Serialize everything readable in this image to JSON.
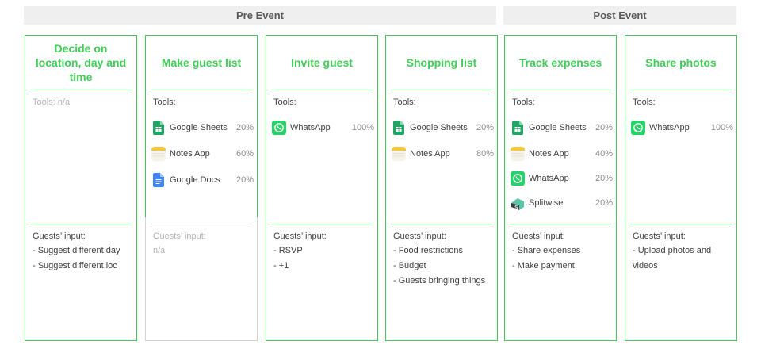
{
  "phases": {
    "pre": "Pre Event",
    "post": "Post Event"
  },
  "tools_label": "Tools:",
  "tools_na_label": "Tools: n/a",
  "inputs_label": "Guests’ input:",
  "colors": {
    "accent": "#3fce56",
    "border": "#47c757",
    "phase_bg": "#efefef"
  },
  "cards": [
    {
      "title": "Decide on location, day and time",
      "tools": [],
      "inputs": [
        "- Suggest different day",
        "- Suggest different loc"
      ]
    },
    {
      "title": "Make guest list",
      "tools": [
        {
          "name": "Google Sheets",
          "pct": "20%",
          "icon": "google-sheets-icon"
        },
        {
          "name": "Notes App",
          "pct": "60%",
          "icon": "notes-app-icon"
        },
        {
          "name": "Google Docs",
          "pct": "20%",
          "icon": "google-docs-icon"
        }
      ],
      "inputs": [
        "n/a"
      ]
    },
    {
      "title": "Invite guest",
      "tools": [
        {
          "name": "WhatsApp",
          "pct": "100%",
          "icon": "whatsapp-icon"
        }
      ],
      "inputs": [
        "- RSVP",
        "- +1"
      ]
    },
    {
      "title": "Shopping list",
      "tools": [
        {
          "name": "Google Sheets",
          "pct": "20%",
          "icon": "google-sheets-icon"
        },
        {
          "name": "Notes App",
          "pct": "80%",
          "icon": "notes-app-icon"
        }
      ],
      "inputs": [
        "- Food restrictions",
        "- Budget",
        "- Guests bringing things"
      ]
    },
    {
      "title": "Track expenses",
      "tools": [
        {
          "name": "Google Sheets",
          "pct": "20%",
          "icon": "google-sheets-icon"
        },
        {
          "name": "Notes App",
          "pct": "40%",
          "icon": "notes-app-icon"
        },
        {
          "name": "WhatsApp",
          "pct": "20%",
          "icon": "whatsapp-icon"
        },
        {
          "name": "Splitwise",
          "pct": "20%",
          "icon": "splitwise-icon"
        }
      ],
      "inputs": [
        "- Share expenses",
        "- Make payment"
      ]
    },
    {
      "title": "Share photos",
      "tools": [
        {
          "name": "WhatsApp",
          "pct": "100%",
          "icon": "whatsapp-icon"
        }
      ],
      "inputs": [
        "- Upload photos and",
        "videos"
      ]
    }
  ]
}
